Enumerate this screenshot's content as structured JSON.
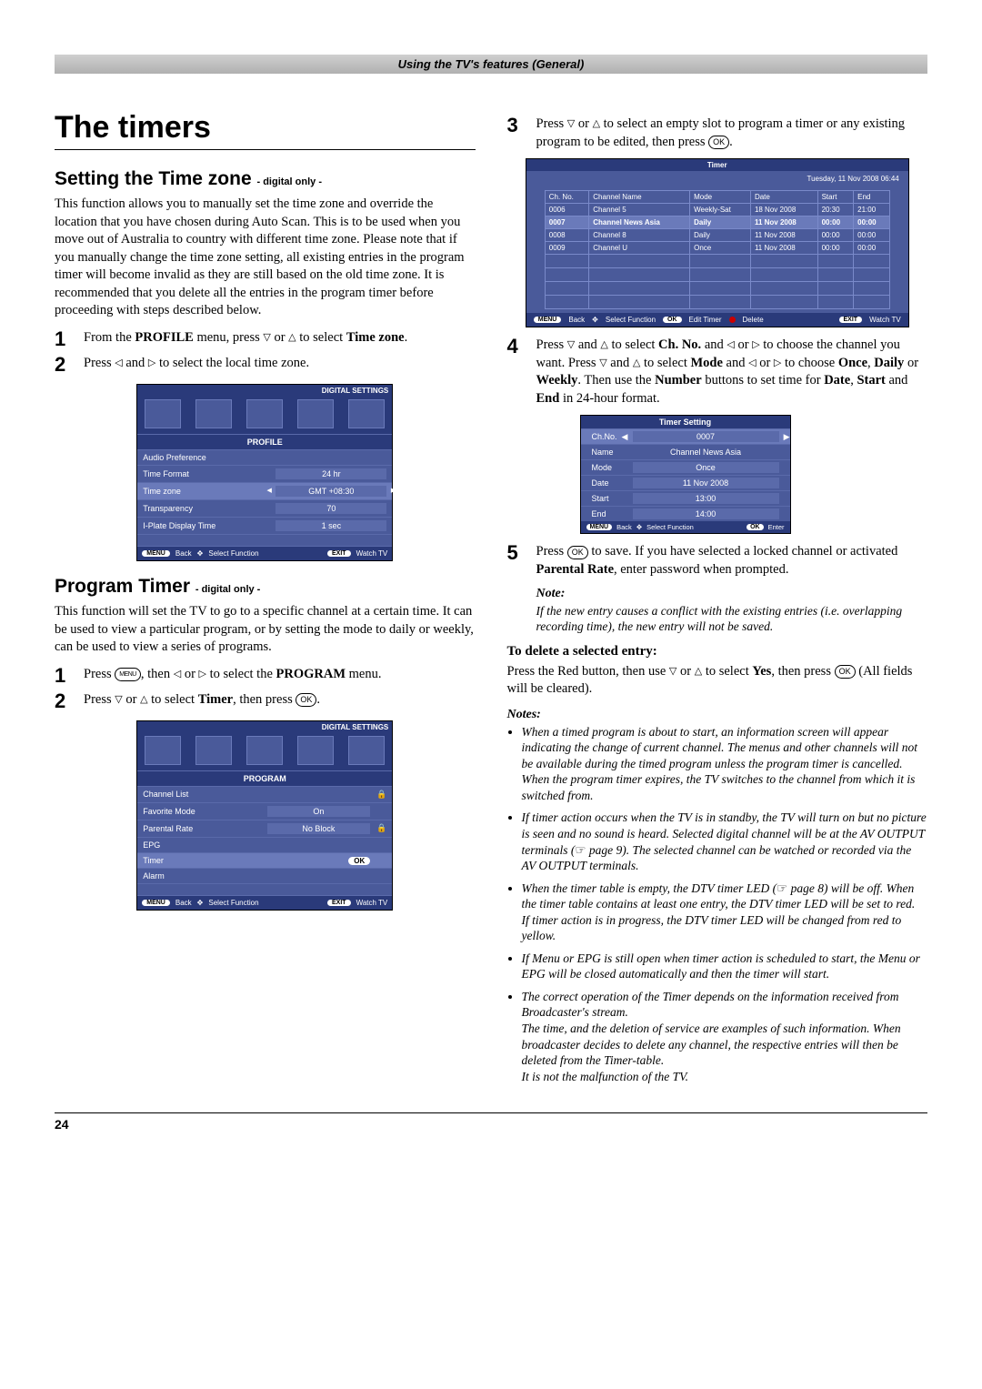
{
  "header_bar": "Using the TV's features (General)",
  "page_title": "The timers",
  "section1": {
    "title": "Setting the Time zone",
    "sub": " - digital only -",
    "intro": "This function allows you to manually set the time zone and override the location that you have chosen during Auto Scan. This is to be used when you move out of Australia to country with different time zone. Please note that if you manually change the time zone setting, all existing entries in the program timer will become invalid as they are still based on the old time zone. It is recommended that you delete all the entries in the program timer before proceeding with steps described below.",
    "step1_a": "From the ",
    "step1_b": "PROFILE",
    "step1_c": " menu, press ",
    "step1_d": " or ",
    "step1_e": " to select ",
    "step1_f": "Time zone",
    "step1_g": ".",
    "step2_a": "Press ",
    "step2_b": " and ",
    "step2_c": " to select the local time zone."
  },
  "osd_profile": {
    "tag": "DIGITAL SETTINGS",
    "section": "PROFILE",
    "rows": [
      {
        "label": "Audio Preference",
        "value": ""
      },
      {
        "label": "Time Format",
        "value": "24 hr"
      },
      {
        "label": "Time zone",
        "value": "GMT +08:30",
        "hi": true,
        "arrows": true
      },
      {
        "label": "Transparency",
        "value": "70"
      },
      {
        "label": "I-Plate Display Time",
        "value": "1 sec"
      }
    ],
    "footer": {
      "menu": "MENU",
      "back": "Back",
      "sel": "Select Function",
      "exit": "EXIT",
      "watch": "Watch TV"
    }
  },
  "section2": {
    "title": "Program Timer",
    "sub": " - digital only -",
    "intro": "This function will set the TV to go to a specific channel at a certain time. It can be used to view a particular program, or by setting the mode to daily or weekly, can be used to view a series of programs.",
    "step1_a": "Press ",
    "step1_b": ", then ",
    "step1_c": " or ",
    "step1_d": " to select the ",
    "step1_e": "PROGRAM",
    "step1_f": " menu.",
    "step2_a": "Press ",
    "step2_b": " or ",
    "step2_c": " to select ",
    "step2_d": "Timer",
    "step2_e": ", then press ",
    "step2_f": "."
  },
  "osd_program": {
    "tag": "DIGITAL SETTINGS",
    "section": "PROGRAM",
    "rows": [
      {
        "label": "Channel List",
        "value": "",
        "lock": "🔒"
      },
      {
        "label": "Favorite Mode",
        "value": "On"
      },
      {
        "label": "Parental Rate",
        "value": "No Block",
        "lock": "🔒"
      },
      {
        "label": "EPG",
        "value": ""
      },
      {
        "label": "Timer",
        "value": "OK",
        "hi": true,
        "ok": true
      },
      {
        "label": "Alarm",
        "value": ""
      }
    ],
    "footer": {
      "menu": "MENU",
      "back": "Back",
      "sel": "Select Function",
      "exit": "EXIT",
      "watch": "Watch TV"
    }
  },
  "right": {
    "step3_a": "Press ",
    "step3_b": " or ",
    "step3_c": " to select an empty slot to program a timer or any existing program to be edited, then press ",
    "step3_d": ".",
    "step4_a": "Press ",
    "step4_b": " and ",
    "step4_c": " to select ",
    "step4_d": "Ch. No.",
    "step4_e": " and ",
    "step4_f": " or ",
    "step4_g": " to choose the channel you want. Press ",
    "step4_h": " and ",
    "step4_i": " to select ",
    "step4_j": "Mode",
    "step4_k": " and ",
    "step4_l": " or ",
    "step4_m": " to choose ",
    "step4_n": "Once",
    "step4_o": ", ",
    "step4_p": "Daily",
    "step4_q": " or ",
    "step4_r": "Weekly",
    "step4_s": ". Then use the ",
    "step4_t": "Number",
    "step4_u": " buttons to set time for ",
    "step4_v": "Date",
    "step4_w": ", ",
    "step4_x": "Start",
    "step4_y": " and ",
    "step4_z": "End",
    "step4_aa": " in 24-hour format.",
    "step5_a": "Press ",
    "step5_b": " to save. If you have selected a locked channel or activated ",
    "step5_c": "Parental Rate",
    "step5_d": ", enter password when prompted.",
    "note_h": "Note:",
    "note": "If the new entry causes a conflict with the existing entries (i.e. overlapping recording time), the new entry will not be saved.",
    "del_h": "To delete a selected entry:",
    "del_a": "Press the Red button, then use ",
    "del_b": " or ",
    "del_c": " to select ",
    "del_d": "Yes",
    "del_e": ", then press ",
    "del_f": " (All fields will be cleared).",
    "notes_h": "Notes:",
    "notes": [
      "When a timed program is about to start, an information screen will appear indicating the change of current channel. The menus and other channels will not be available during the timed program unless the program timer is cancelled. When the program timer expires, the TV switches to the channel from which it is switched from.",
      "If timer action occurs when the TV is in standby, the TV will turn on but no picture is seen and no sound is heard. Selected digital channel will be at the AV OUTPUT terminals (☞ page 9). The selected channel can be watched or recorded via the AV OUTPUT terminals.",
      "When the timer table is empty, the DTV timer LED (☞ page 8) will be off. When the timer table contains at least one entry, the DTV timer LED will be set to red.\nIf timer action is in progress, the DTV timer LED will be changed from red to yellow.",
      "If Menu or EPG is still open when timer action is scheduled to start, the Menu or EPG will be closed automatically and then the timer will start.",
      "The correct operation of the Timer depends on the information received from Broadcaster's stream.\nThe time, and the deletion of service are examples of such information. When broadcaster decides to delete any channel, the respective entries will then be deleted from the Timer-table.\nIt is not the malfunction of the TV."
    ]
  },
  "timer_osd": {
    "title": "Timer",
    "date": "Tuesday, 11 Nov 2008   06:44",
    "headers": [
      "Ch. No.",
      "Channel Name",
      "Mode",
      "Date",
      "Start",
      "End"
    ],
    "rows": [
      [
        "0006",
        "Channel 5",
        "Weekly-Sat",
        "18 Nov 2008",
        "20:30",
        "21:00"
      ],
      [
        "0007",
        "Channel News Asia",
        "Daily",
        "11 Nov 2008",
        "00:00",
        "00:00"
      ],
      [
        "0008",
        "Channel 8",
        "Daily",
        "11 Nov 2008",
        "00:00",
        "00:00"
      ],
      [
        "0009",
        "Channel U",
        "Once",
        "11 Nov 2008",
        "00:00",
        "00:00"
      ]
    ],
    "hi_index": 1,
    "footer": {
      "menu": "MENU",
      "back": "Back",
      "sel": "Select Function",
      "ok": "OK",
      "edit": "Edit Timer",
      "del": "Delete",
      "exit": "EXIT",
      "watch": "Watch TV"
    }
  },
  "ts_osd": {
    "title": "Timer Setting",
    "rows": [
      {
        "l": "Ch.No.",
        "v": "0007",
        "hi": true
      },
      {
        "l": "Name",
        "v": "Channel News Asia",
        "plain": true
      },
      {
        "l": "Mode",
        "v": "Once"
      },
      {
        "l": "Date",
        "v": "11 Nov 2008"
      },
      {
        "l": "Start",
        "v": "13:00"
      },
      {
        "l": "End",
        "v": "14:00"
      }
    ],
    "footer": {
      "menu": "MENU",
      "back": "Back",
      "sel": "Select Function",
      "ok": "OK",
      "enter": "Enter"
    }
  },
  "page_num": "24"
}
